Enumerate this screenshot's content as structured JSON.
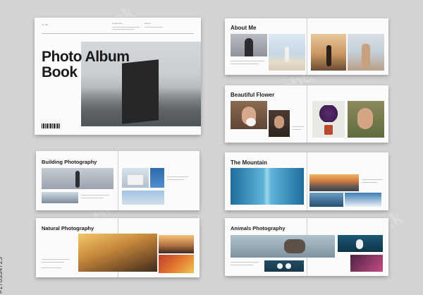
{
  "cover": {
    "vol": "Vol. 045",
    "prepared_label": "Prepared By :",
    "issue_label": "Issue In :",
    "title_line1": "Photo Album",
    "title_line2": "Book"
  },
  "spreads": {
    "about": {
      "title": "About Me"
    },
    "flower": {
      "title": "Beautiful Flower"
    },
    "building": {
      "title": "Building Photography"
    },
    "mountain": {
      "title": "The Mountain"
    },
    "natural": {
      "title": "Natural Photography"
    },
    "animals": {
      "title": "Animals Photography"
    }
  },
  "watermark": {
    "text": "Adobe Stock"
  },
  "stock_id": "#178334725",
  "colors": {
    "background": "#d3d3d3",
    "paper": "#fbfbfb",
    "title_text": "#1a1a1a"
  }
}
